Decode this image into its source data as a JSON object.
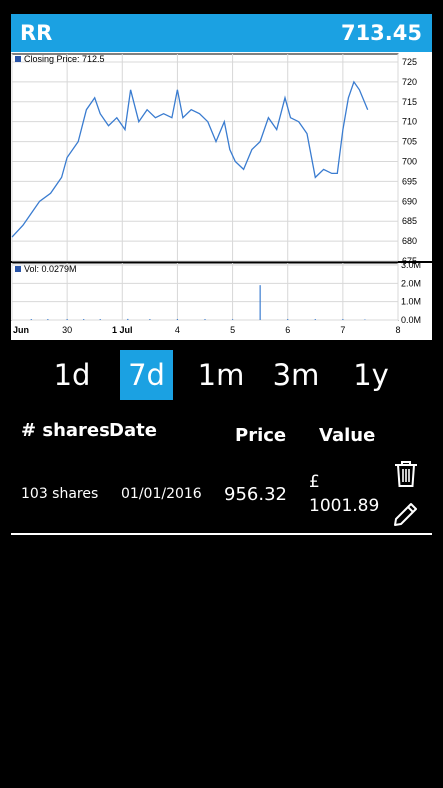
{
  "header": {
    "symbol": "RR",
    "price": "713.45"
  },
  "chart": {
    "price_legend": "Closing Price: 712.5",
    "volume_legend": "Vol: 0.0279M",
    "price_ticks": [
      "725",
      "720",
      "715",
      "710",
      "705",
      "700",
      "695",
      "690",
      "685",
      "680",
      "675"
    ],
    "volume_ticks": [
      "3.0M",
      "2.0M",
      "1.0M",
      "0.0M"
    ],
    "x_ticks": [
      "Jun",
      "30",
      "1 Jul",
      "4",
      "5",
      "6",
      "7",
      "8"
    ]
  },
  "chart_data": {
    "type": "line",
    "title": "",
    "xlabel": "",
    "ylabel": "",
    "price_series_name": "Closing Price",
    "volume_series_name": "Vol",
    "ylim": [
      675,
      727
    ],
    "volume_ylim": [
      0,
      3.0
    ],
    "x_categories": [
      "Jun",
      "30",
      "1 Jul",
      "4",
      "5",
      "6",
      "7",
      "8"
    ],
    "price": [
      [
        0,
        681
      ],
      [
        0.2,
        684
      ],
      [
        0.35,
        687
      ],
      [
        0.5,
        690
      ],
      [
        0.7,
        692
      ],
      [
        0.9,
        696
      ],
      [
        1.0,
        701
      ],
      [
        1.2,
        705
      ],
      [
        1.35,
        713
      ],
      [
        1.5,
        716
      ],
      [
        1.6,
        712
      ],
      [
        1.75,
        709
      ],
      [
        1.9,
        711
      ],
      [
        2.05,
        708
      ],
      [
        2.15,
        718
      ],
      [
        2.3,
        710
      ],
      [
        2.45,
        713
      ],
      [
        2.6,
        711
      ],
      [
        2.75,
        712
      ],
      [
        2.9,
        711
      ],
      [
        3.0,
        718
      ],
      [
        3.1,
        711
      ],
      [
        3.25,
        713
      ],
      [
        3.4,
        712
      ],
      [
        3.55,
        710
      ],
      [
        3.7,
        705
      ],
      [
        3.85,
        710
      ],
      [
        3.95,
        703
      ],
      [
        4.05,
        700
      ],
      [
        4.2,
        698
      ],
      [
        4.35,
        703
      ],
      [
        4.5,
        705
      ],
      [
        4.65,
        711
      ],
      [
        4.8,
        708
      ],
      [
        4.95,
        716
      ],
      [
        5.05,
        711
      ],
      [
        5.2,
        710
      ],
      [
        5.35,
        707
      ],
      [
        5.5,
        696
      ],
      [
        5.65,
        698
      ],
      [
        5.8,
        697
      ],
      [
        5.9,
        697
      ],
      [
        6.0,
        708
      ],
      [
        6.1,
        716
      ],
      [
        6.2,
        720
      ],
      [
        6.3,
        718
      ],
      [
        6.45,
        713
      ]
    ],
    "volume": [
      [
        0.35,
        0.05
      ],
      [
        0.65,
        0.05
      ],
      [
        1.0,
        0.05
      ],
      [
        1.3,
        0.05
      ],
      [
        1.6,
        0.05
      ],
      [
        2.1,
        0.06
      ],
      [
        2.5,
        0.05
      ],
      [
        3.0,
        0.05
      ],
      [
        3.5,
        0.05
      ],
      [
        4.0,
        0.04
      ],
      [
        4.5,
        1.9
      ],
      [
        5.0,
        0.05
      ],
      [
        5.5,
        0.05
      ],
      [
        6.0,
        0.05
      ],
      [
        6.4,
        0.03
      ]
    ]
  },
  "ranges": [
    "1d",
    "7d",
    "1m",
    "3m",
    "1y"
  ],
  "active_range": "7d",
  "table": {
    "headers": {
      "shares": "# shares",
      "date": "Date",
      "price": "Price",
      "value": "Value"
    },
    "rows": [
      {
        "shares": "103 shares",
        "date": "01/01/2016",
        "price": "956.32",
        "currency": "£",
        "value": "1001.89"
      }
    ]
  },
  "icons": {
    "delete": "trash-icon",
    "edit": "pencil-icon"
  },
  "colors": {
    "accent": "#1ba1e2",
    "line": "#3a7cd0",
    "background": "#000000"
  }
}
